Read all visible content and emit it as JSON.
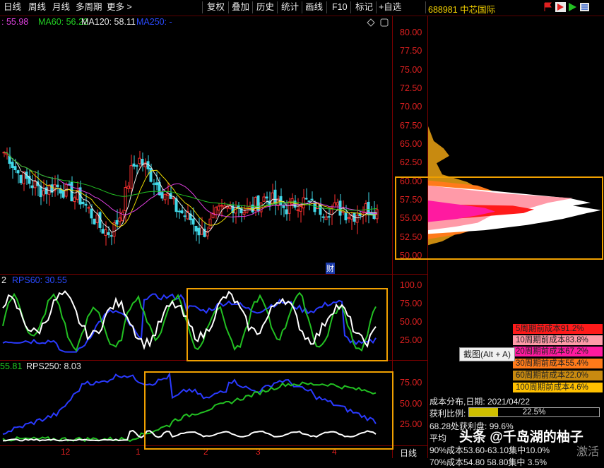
{
  "toolbar": {
    "buttons": [
      "日线",
      "周线",
      "月线",
      "多周期",
      "更多 >",
      "复权",
      "叠加",
      "历史",
      "统计",
      "画线",
      "F10",
      "标记",
      "+自选"
    ],
    "symbol": "688981 中芯国际"
  },
  "ma": {
    "ma_prefix_value": ": 55.98",
    "ma60": "MA60: 56.22",
    "ma120": "MA120: 58.11",
    "ma250": "MA250: -"
  },
  "price_axis": {
    "ticks": [
      "80.00",
      "77.50",
      "75.00",
      "72.50",
      "70.00",
      "67.50",
      "65.00",
      "62.50",
      "60.00",
      "57.50",
      "55.00",
      "52.50",
      "50.00"
    ],
    "ymin": 50,
    "ymax": 80
  },
  "panel2": {
    "left": "2",
    "label": "RPS60: 30.55",
    "ticks": [
      "100.0",
      "75.00",
      "50.00",
      "25.00"
    ]
  },
  "panel3": {
    "left": "55.81",
    "label": "RPS250: 8.03",
    "ticks": [
      "75.00",
      "50.00",
      "25.00"
    ]
  },
  "cai_marker": "财",
  "x_labels": [
    "12",
    "1",
    "2",
    "3",
    "4"
  ],
  "period": "日线",
  "cost_legend": [
    {
      "text": "5周期前成本91.2%",
      "color": "#ff1a1a"
    },
    {
      "text": "10周期前成本83.8%",
      "color": "#ff9aa8"
    },
    {
      "text": "20周期前成本67.2%",
      "color": "#ff1aa0"
    },
    {
      "text": "30周期前成本55.4%",
      "color": "#ff7a1a"
    },
    {
      "text": "60周期前成本22.0%",
      "color": "#c88a10"
    },
    {
      "text": "100周期前成本4.6%",
      "color": "#ffc000"
    }
  ],
  "tooltip": "截图(Alt + A)",
  "chip": {
    "date_line": "成本分布,日期:  2021/04/22",
    "profit_label": "获利比例:",
    "profit_value": "22.5%",
    "profit_fraction": 0.225,
    "line3": "68.28处获利盘:  99.6%",
    "line4": "平均",
    "line5": "90%成本53.60-63.10集中10.0%",
    "line6": "70%成本54.80 58.80集中 3.5%"
  },
  "watermark": "头条 @千岛湖的柚子",
  "watermark2": "激活"
}
